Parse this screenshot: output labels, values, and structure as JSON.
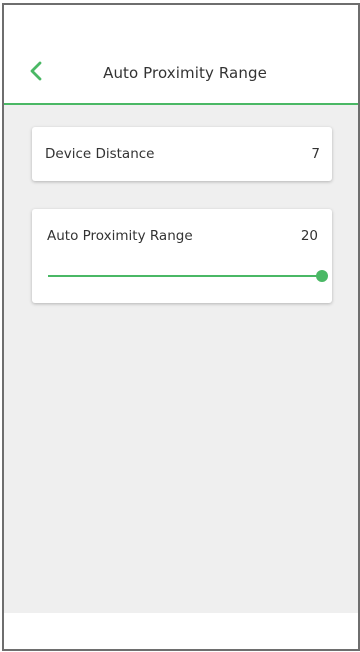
{
  "header": {
    "title": "Auto Proximity Range",
    "back_icon": "chevron-left-icon"
  },
  "device_distance": {
    "label": "Device Distance",
    "value": "7"
  },
  "auto_proximity": {
    "label": "Auto Proximity Range",
    "value": "20",
    "slider_fraction": 1.0
  },
  "colors": {
    "accent": "#4ab865",
    "background": "#efefef",
    "card": "#ffffff",
    "text": "#333333"
  }
}
